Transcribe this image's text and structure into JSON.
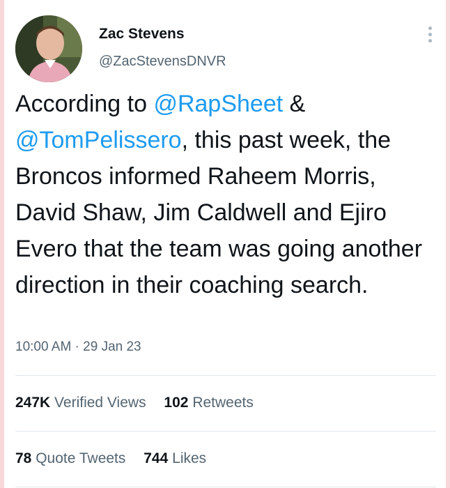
{
  "author": {
    "name": "Zac Stevens",
    "handle": "@ZacStevensDNVR"
  },
  "tweet": {
    "text_1": "According to ",
    "mention_1": "@RapSheet",
    "text_2": " & ",
    "mention_2": "@TomPelissero",
    "text_3": ", this past week, the Broncos informed Raheem Morris, David Shaw, Jim Caldwell and Ejiro Evero that the team was going another direction in their coaching search."
  },
  "meta": {
    "timestamp": "10:00 AM · 29 Jan 23"
  },
  "stats": {
    "views_count": "247K",
    "views_label": "Verified Views",
    "retweets_count": "102",
    "retweets_label": "Retweets",
    "quotes_count": "78",
    "quotes_label": "Quote Tweets",
    "likes_count": "744",
    "likes_label": "Likes"
  },
  "icons": {
    "more": "more-vertical-icon"
  },
  "colors": {
    "mention": "#1d9bf0",
    "secondary_text": "#536471",
    "primary_text": "#0f1419",
    "edge": "#f7d7d9"
  }
}
